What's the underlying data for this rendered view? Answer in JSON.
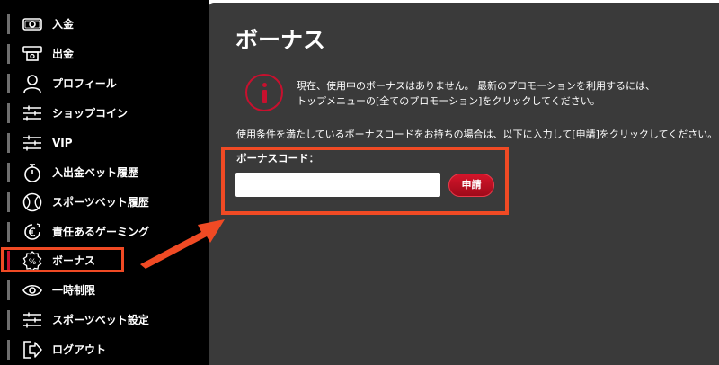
{
  "sidebar": {
    "items": [
      {
        "label": "入金",
        "icon": "cash-icon"
      },
      {
        "label": "出金",
        "icon": "withdraw-icon"
      },
      {
        "label": "プロフィール",
        "icon": "user-icon"
      },
      {
        "label": "ショップコイン",
        "icon": "sliders-icon"
      },
      {
        "label": "VIP",
        "icon": "sliders-icon"
      },
      {
        "label": "入出金ベット履歴",
        "icon": "stopwatch-icon"
      },
      {
        "label": "スポーツベット履歴",
        "icon": "ball-icon"
      },
      {
        "label": "責任あるゲーミング",
        "icon": "euro-icon"
      },
      {
        "label": "ボーナス",
        "icon": "percent-badge-icon"
      },
      {
        "label": "一時制限",
        "icon": "eye-icon"
      },
      {
        "label": "スポーツベット設定",
        "icon": "sliders-icon"
      },
      {
        "label": "ログアウト",
        "icon": "logout-icon"
      }
    ],
    "active_index": 8
  },
  "main": {
    "title": "ボーナス",
    "notice_line1": "現在、使用中のボーナスはありません。 最新のプロモーションを利用するには、",
    "notice_line2": "トップメニューの[全てのプロモーション]をクリックしてください。",
    "instruction": "使用条件を満たしているボーナスコードをお持ちの場合は、以下に入力して[申請]をクリックしてください。",
    "form": {
      "label": "ボーナスコード：",
      "input_value": "",
      "apply_label": "申請"
    }
  },
  "colors": {
    "sidebar_bg": "#000000",
    "main_bg": "#3a3a3a",
    "accent_red": "#c8102e",
    "highlight_orange": "#f04a24"
  }
}
